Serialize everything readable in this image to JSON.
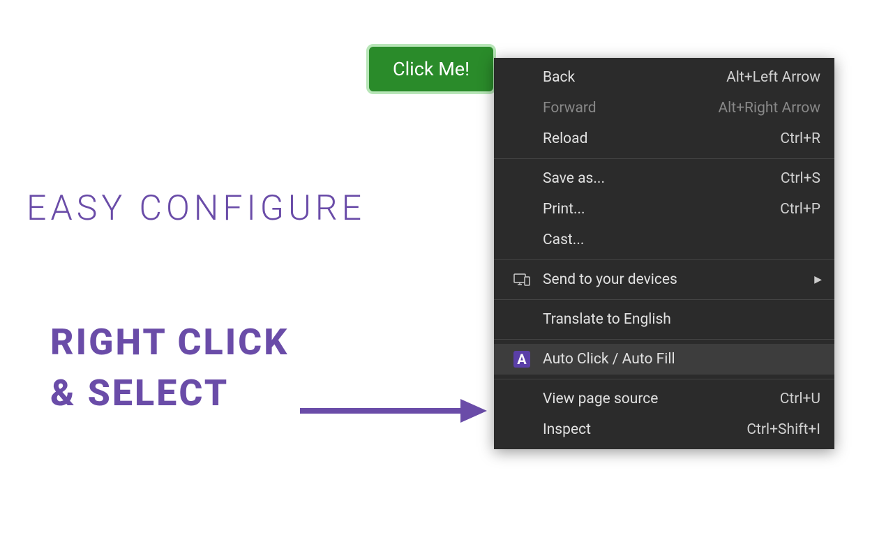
{
  "button": {
    "label": "Click Me!"
  },
  "headings": {
    "light": "EASY CONFIGURE",
    "bold_line1": "RIGHT CLICK",
    "bold_line2": "& SELECT"
  },
  "menu": {
    "items": [
      {
        "label": "Back",
        "shortcut": "Alt+Left Arrow",
        "disabled": false
      },
      {
        "label": "Forward",
        "shortcut": "Alt+Right Arrow",
        "disabled": true
      },
      {
        "label": "Reload",
        "shortcut": "Ctrl+R",
        "disabled": false
      }
    ],
    "items2": [
      {
        "label": "Save as...",
        "shortcut": "Ctrl+S"
      },
      {
        "label": "Print...",
        "shortcut": "Ctrl+P"
      },
      {
        "label": "Cast..."
      }
    ],
    "send_devices": "Send to your devices",
    "translate": "Translate to English",
    "extension": "Auto Click / Auto Fill",
    "extension_icon_letter": "A",
    "items3": [
      {
        "label": "View page source",
        "shortcut": "Ctrl+U"
      },
      {
        "label": "Inspect",
        "shortcut": "Ctrl+Shift+I"
      }
    ]
  }
}
